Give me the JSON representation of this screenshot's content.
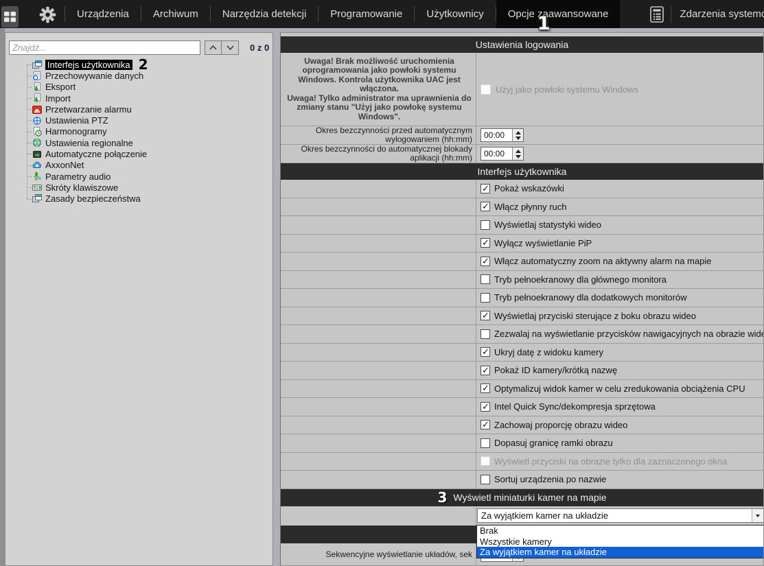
{
  "topbar": {
    "grid_icon": "app-grid-icon",
    "gear_icon": "settings-gear-icon",
    "menu": [
      "Urządzenia",
      "Archiwum",
      "Narzędzia detekcji",
      "Programowanie",
      "Użytkownicy"
    ],
    "active_tab": "Opcje zaawansowane",
    "events": {
      "icon": "system-events-icon",
      "label": "Zdarzenia systemowe"
    }
  },
  "annotations": {
    "tab": "1",
    "tree": "2",
    "header": "3"
  },
  "sidebar": {
    "search_placeholder": "Znajdź...",
    "search_counter": "0 z 0",
    "items": [
      {
        "label": "Interfejs użytkownika",
        "icon": "user-interface-icon",
        "selected": true
      },
      {
        "label": "Przechowywanie danych",
        "icon": "data-storage-icon"
      },
      {
        "label": "Eksport",
        "icon": "export-icon"
      },
      {
        "label": "Import",
        "icon": "import-icon"
      },
      {
        "label": "Przetwarzanie alarmu",
        "icon": "alarm-processing-icon"
      },
      {
        "label": "Ustawienia PTZ",
        "icon": "ptz-settings-icon"
      },
      {
        "label": "Harmonogramy",
        "icon": "schedules-icon"
      },
      {
        "label": "Ustawienia regionalne",
        "icon": "regional-settings-icon"
      },
      {
        "label": "Automatyczne połączenie",
        "icon": "auto-connect-icon"
      },
      {
        "label": "AxxonNet",
        "icon": "axxonnet-cloud-icon"
      },
      {
        "label": "Parametry audio",
        "icon": "audio-parameters-icon"
      },
      {
        "label": "Skróty klawiszowe",
        "icon": "keyboard-shortcuts-icon"
      },
      {
        "label": "Zasady bezpieczeństwa",
        "icon": "security-policy-icon"
      }
    ]
  },
  "panel": {
    "login_header": "Ustawienia logowania",
    "warning_text": "Uwaga! Brak możliwość uruchomienia\noprogramowania jako powłoki systemu\nWindows. Kontrola użytkownika UAC jest\nwłączona.\nUwaga! Tylko administrator ma uprawnienia do\nzmiany stanu \"Użyj jako powłokę systemu\nWindows\".",
    "shell_checkbox": {
      "label": "Użyj jako powłoki systemu Windows",
      "checked": false,
      "disabled": true
    },
    "logout_row": {
      "label": "Okres bezczynności przed automatycznym wylogowaniem (hh:mm)",
      "value": "00:00"
    },
    "lock_row": {
      "label": "Okres bezczynności do automatycznej blokady aplikacji (hh:mm)",
      "value": "00:00"
    },
    "ui_header": "Interfejs użytkownika",
    "checkbox_rows": [
      {
        "label": "Pokaż wskazówki",
        "checked": true
      },
      {
        "label": "Włącz płynny ruch",
        "checked": true
      },
      {
        "label": "Wyświetlaj statystyki wideo",
        "checked": false
      },
      {
        "label": "Wyłącz wyświetlanie PiP",
        "checked": true
      },
      {
        "label": "Włącz automatyczny zoom na aktywny alarm na mapie",
        "checked": true
      },
      {
        "label": "Tryb pełnoekranowy dla głównego monitora",
        "checked": false
      },
      {
        "label": "Tryb pełnoekranowy dla dodatkowych monitorów",
        "checked": false
      },
      {
        "label": "Wyświetlaj przyciski sterujące z boku obrazu wideo",
        "checked": true
      },
      {
        "label": "Zezwalaj na wyświetlanie przycisków nawigacyjnych na obrazie wideo",
        "checked": false
      },
      {
        "label": "Ukryj datę z widoku kamery",
        "checked": true
      },
      {
        "label": "Pokaż ID kamery/krótką nazwę",
        "checked": true
      },
      {
        "label": "Optymalizuj widok kamer w celu zredukowania obciążenia CPU",
        "checked": true
      },
      {
        "label": "Intel Quick Sync/dekompresja sprzętowa",
        "checked": true
      },
      {
        "label": "Zachowaj proporcję obrazu wideo",
        "checked": true
      },
      {
        "label": "Dopasuj granicę ramki obrazu",
        "checked": false
      },
      {
        "label": "Wyświetl przyciski na obrazie tylko dla zaznaczonego okna",
        "checked": false,
        "disabled": true
      },
      {
        "label": "Sortuj urządzenia po nazwie",
        "checked": false
      }
    ],
    "thumbnails_header": "Wyświetl miniaturki kamer na mapie",
    "thumbnails_select": {
      "value": "Za wyjątkiem kamer na układzie",
      "options": [
        "Brak",
        "Wszystkie kamery",
        "Za wyjątkiem kamer na układzie"
      ],
      "selected_index": 2
    },
    "sequence_row": {
      "label": "Sekwencyjne wyświetlanie układów, sek",
      "value": ""
    }
  },
  "colors": {
    "topbar_bg": "#1d1d1d",
    "active_tab_bg": "#0a0a0a",
    "section_header_bg": "#2b2b2b",
    "row_bg": "#c6c6c6",
    "selection_blue": "#1160d4",
    "tree_selected_bg": "#000000"
  }
}
